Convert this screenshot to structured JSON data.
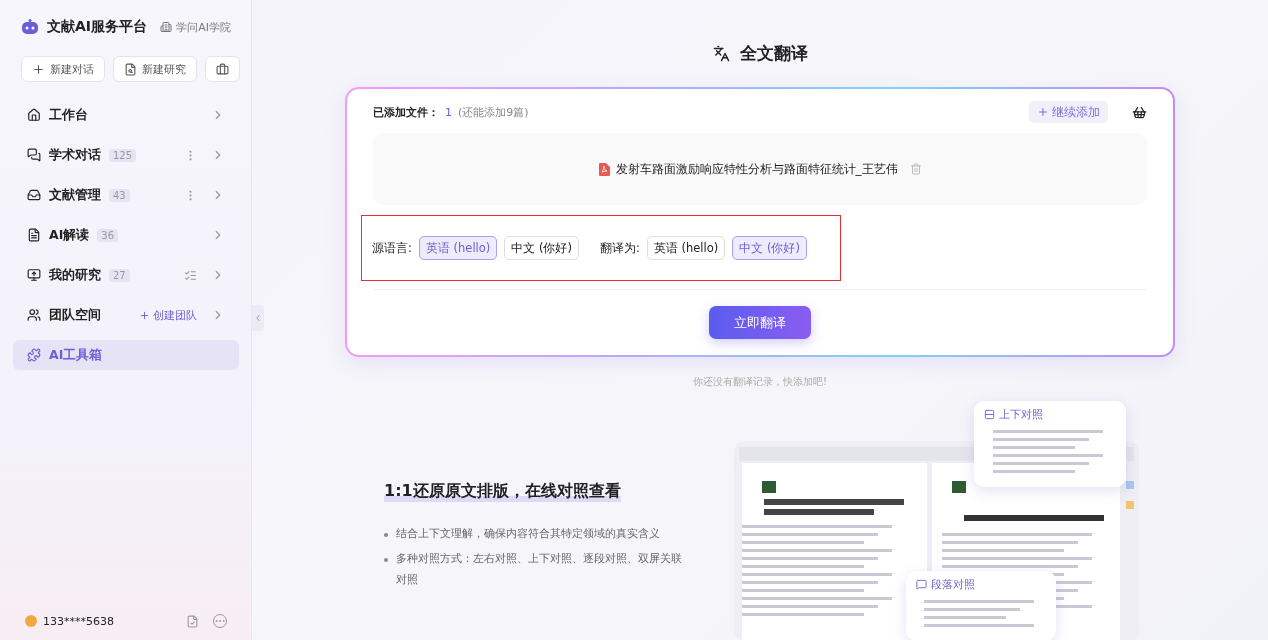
{
  "brand": {
    "title": "文献AI服务平台",
    "academy": "学问AI学院"
  },
  "actions": [
    {
      "label": "新建对话"
    },
    {
      "label": "新建研究"
    }
  ],
  "nav": [
    {
      "label": "工作台",
      "kind": "plain",
      "selected": false
    },
    {
      "label": "学术对话",
      "kind": "menu",
      "count": "125",
      "selected": false
    },
    {
      "label": "文献管理",
      "kind": "menu",
      "count": "43",
      "selected": false
    },
    {
      "label": "AI解读",
      "kind": "plain",
      "count": "36",
      "selected": false
    },
    {
      "label": "我的研究",
      "kind": "list",
      "count": "27",
      "selected": false
    },
    {
      "label": "团队空间",
      "kind": "link",
      "link": "创建团队",
      "selected": false
    },
    {
      "label": "AI工具箱",
      "kind": "plain",
      "selected": true
    }
  ],
  "user": {
    "name": "133****5638"
  },
  "page": {
    "title": "全文翻译"
  },
  "upload": {
    "label": "已添加文件：",
    "count": "1",
    "hint": "(还能添加9篇)",
    "add_button": "继续添加",
    "file": "发射车路面激励响应特性分析与路面特征统计_王艺伟"
  },
  "source": {
    "label": "源语言:",
    "options": [
      {
        "label": "英语 (hello)",
        "selected": true
      },
      {
        "label": "中文 (你好)",
        "selected": false
      }
    ]
  },
  "target": {
    "label": "翻译为:",
    "options": [
      {
        "label": "英语 (hello)",
        "selected": false
      },
      {
        "label": "中文 (你好)",
        "selected": true
      }
    ]
  },
  "translate_button": "立即翻译",
  "empty_note": "你还没有翻译记录，快添加吧!",
  "feature": {
    "heading": "1:1还原原文排版，在线对照查看",
    "bullets": [
      "结合上下文理解，确保内容符合其特定领域的真实含义",
      "多种对照方式：左右对照、上下对照、逐段对照、双屏关联对照"
    ],
    "illustration": {
      "cards": [
        "上下对照",
        "段落对照"
      ]
    }
  }
}
